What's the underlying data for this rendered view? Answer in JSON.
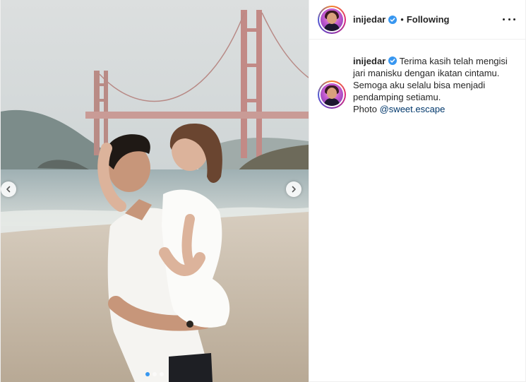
{
  "post": {
    "author": {
      "username": "inijedar",
      "verified": true,
      "follow_status": "Following",
      "separator": "•"
    },
    "media": {
      "description_icon": "photo",
      "carousel_total": 3,
      "carousel_active_index": 0
    },
    "caption": {
      "username": "inijedar",
      "lines": [
        "Terima kasih telah mengisi",
        "jari manisku dengan ikatan cintamu.",
        "Semoga aku selalu bisa menjadi",
        "pendamping setiamu."
      ],
      "credit_prefix": "Photo",
      "credit_mention": "@sweet.escape"
    },
    "icons": {
      "verified": "verified-badge-icon",
      "more": "more-options-icon",
      "prev": "chevron-left-icon",
      "next": "chevron-right-icon"
    },
    "colors": {
      "verified": "#3897f0",
      "mention": "#00376b",
      "active_dot": "#3897f0"
    }
  }
}
